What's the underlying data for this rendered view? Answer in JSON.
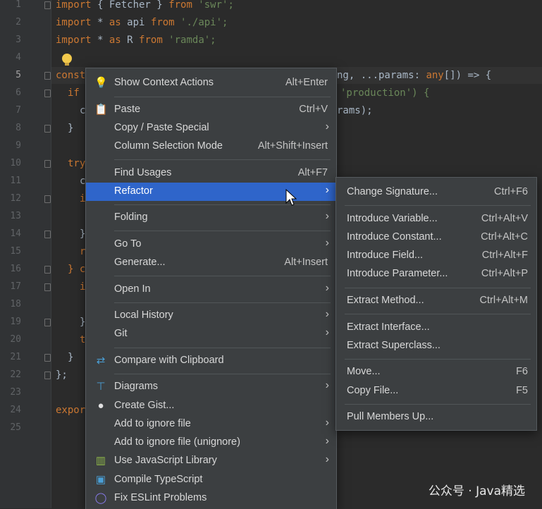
{
  "editor": {
    "line_numbers": [
      "1",
      "2",
      "3",
      "4",
      "5",
      "6",
      "7",
      "8",
      "9",
      "10",
      "11",
      "12",
      "13",
      "14",
      "15",
      "16",
      "17",
      "18",
      "19",
      "20",
      "21",
      "22",
      "23",
      "24",
      "25"
    ],
    "code_lines": [
      [
        "import",
        " { Fetcher } ",
        "from",
        " 'swr';"
      ],
      [
        "import",
        " * ",
        "as",
        " api ",
        "from",
        " './api';"
      ],
      [
        "import",
        " * ",
        "as",
        " R ",
        "from",
        " 'ramda';"
      ]
    ],
    "line5_left": "const",
    "line5_right_a": "ng, ...params: ",
    "line5_right_kw": "any",
    "line5_right_b": "[]) => {",
    "line6_left": "if",
    "line6_right": "'production') {",
    "line7_left": "c",
    "line7_right": "rams);",
    "line8_left": "}",
    "line10_left": "try",
    "line11_left": "c",
    "line12_left": "i",
    "line14_left": "}",
    "line15_left": "r",
    "line16_left": "} c",
    "line17_left": "i",
    "line19_left": "}",
    "line20_left": "t",
    "line21_left": "}",
    "line22_left": "};",
    "line24_left": "expor"
  },
  "context_menu": {
    "items": [
      {
        "label": "Show Context Actions",
        "shortcut": "Alt+Enter",
        "icon": "lightbulb-icon"
      },
      {
        "label": "Paste",
        "shortcut": "Ctrl+V",
        "icon": "clipboard-icon"
      },
      {
        "label": "Copy / Paste Special",
        "shortcut": "",
        "arrow": "›"
      },
      {
        "label": "Column Selection Mode",
        "shortcut": "Alt+Shift+Insert"
      },
      {
        "label": "Find Usages",
        "shortcut": "Alt+F7"
      },
      {
        "label": "Refactor",
        "arrow": "›"
      },
      {
        "label": "Folding",
        "arrow": "›"
      },
      {
        "label": "Go To",
        "arrow": "›"
      },
      {
        "label": "Generate...",
        "shortcut": "Alt+Insert"
      },
      {
        "label": "Open In",
        "arrow": "›"
      },
      {
        "label": "Local History",
        "arrow": "›"
      },
      {
        "label": "Git",
        "arrow": "›"
      },
      {
        "label": "Compare with Clipboard",
        "icon": "compare-icon"
      },
      {
        "label": "Diagrams",
        "arrow": "›",
        "icon": "diagram-icon"
      },
      {
        "label": "Create Gist...",
        "icon": "github-icon"
      },
      {
        "label": "Add to ignore file",
        "arrow": "›"
      },
      {
        "label": "Add to ignore file (unignore)",
        "arrow": "›"
      },
      {
        "label": "Use JavaScript Library",
        "arrow": "›",
        "icon": "library-icon"
      },
      {
        "label": "Compile TypeScript",
        "icon": "typescript-icon"
      },
      {
        "label": "Fix ESLint Problems",
        "icon": "eslint-icon"
      }
    ]
  },
  "refactor_submenu": {
    "items": [
      {
        "label": "Change Signature...",
        "shortcut": "Ctrl+F6"
      },
      {
        "label": "Introduce Variable...",
        "shortcut": "Ctrl+Alt+V"
      },
      {
        "label": "Introduce Constant...",
        "shortcut": "Ctrl+Alt+C"
      },
      {
        "label": "Introduce Field...",
        "shortcut": "Ctrl+Alt+F"
      },
      {
        "label": "Introduce Parameter...",
        "shortcut": "Ctrl+Alt+P"
      },
      {
        "label": "Extract Method...",
        "shortcut": "Ctrl+Alt+M"
      },
      {
        "label": "Extract Interface..."
      },
      {
        "label": "Extract Superclass..."
      },
      {
        "label": "Move...",
        "shortcut": "F6"
      },
      {
        "label": "Copy File...",
        "shortcut": "F5"
      },
      {
        "label": "Pull Members Up..."
      }
    ]
  },
  "watermark": "公众号 · Java精选",
  "colors": {
    "menu_bg": "#3c3f41",
    "selection": "#2f65ca",
    "editor_bg": "#2b2b2b",
    "keyword": "#cc7832",
    "string": "#6a8759"
  }
}
